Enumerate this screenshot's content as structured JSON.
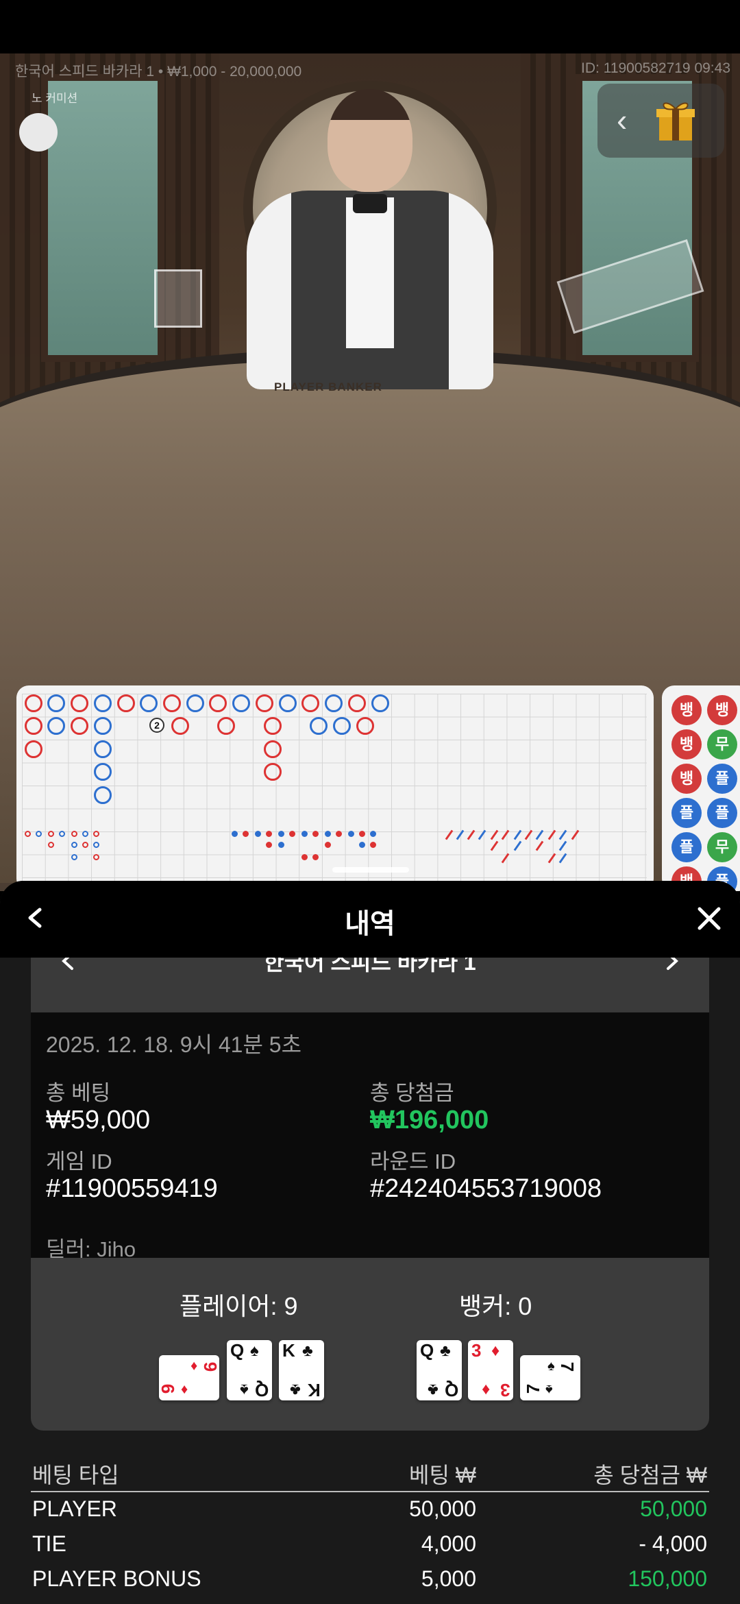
{
  "table_info": {
    "title_left": "한국어 스피드 바카라 1 • ₩1,000 - 20,000,000",
    "id_right": "ID: 11900582719 09:43",
    "commission": "노 커미션",
    "table_sign": "PLAYER BANKER"
  },
  "bead_road": {
    "labels": [
      "뱅",
      "뱅",
      "뱅",
      "무",
      "뱅",
      "플",
      "플",
      "플",
      "플",
      "무",
      "뱅",
      "플"
    ],
    "colors": {
      "banker": "#d33b3b",
      "player": "#2d6fcf",
      "tie": "#3aa64a"
    }
  },
  "sheet": {
    "title": "내역",
    "game_name": "한국어 스피드 바카라 1",
    "date": "2025. 12. 18. 9시 41분 5초",
    "total_bet_label": "총 베팅",
    "total_bet_value": "₩59,000",
    "total_win_label": "총 당첨금",
    "total_win_value": "₩196,000",
    "game_id_label": "게임 ID",
    "game_id_value": "#11900559419",
    "round_id_label": "라운드 ID",
    "round_id_value": "#242404553719008",
    "dealer": "딜러: Jiho"
  },
  "hands": {
    "player_title": "플레이어: 9",
    "banker_title": "뱅커: 0",
    "player_cards": [
      {
        "rank": "9",
        "suit": "♦",
        "color": "red",
        "orientation": "horizontal"
      },
      {
        "rank": "Q",
        "suit": "♠",
        "color": "black",
        "orientation": "vertical"
      },
      {
        "rank": "K",
        "suit": "♣",
        "color": "black",
        "orientation": "vertical"
      }
    ],
    "banker_cards": [
      {
        "rank": "Q",
        "suit": "♣",
        "color": "black",
        "orientation": "vertical"
      },
      {
        "rank": "3",
        "suit": "♦",
        "color": "red",
        "orientation": "vertical"
      },
      {
        "rank": "7",
        "suit": "♠",
        "color": "black",
        "orientation": "horizontal"
      }
    ]
  },
  "bets_table": {
    "headers": {
      "type": "베팅 타입",
      "bet": "베팅 ₩",
      "win": "총 당첨금 ₩"
    },
    "rows": [
      {
        "type": "PLAYER",
        "bet": "50,000",
        "win": "50,000"
      },
      {
        "type": "TIE",
        "bet": "4,000",
        "win": "- 4,000"
      },
      {
        "type": "PLAYER BONUS",
        "bet": "5,000",
        "win": "150,000"
      }
    ]
  },
  "colors": {
    "win_green": "#22c55e",
    "banker_red": "#d33b3b",
    "player_blue": "#2d6fcf"
  }
}
